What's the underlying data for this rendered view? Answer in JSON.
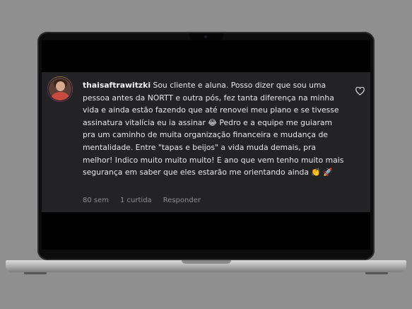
{
  "comment": {
    "username": "thaisaftrawitzki",
    "text": "Sou cliente e aluna. Posso dizer que sou uma pessoa antes da NORTT e outra pós, fez tanta diferença na minha vida e ainda estão fazendo que até renovei meu plano e se tivesse assinatura vitalícia eu ia assinar 😂 Pedro e a equipe me guiaram pra um caminho de muita organização financeira e mudança de mentalidade. Entre \"tapas e beijos\" a vida muda demais, pra melhor! Indico muito muito muito! E ano que vem tenho muito mais segurança em saber que eles estarão me orientando ainda 👏 🚀",
    "time": "80 sem",
    "likes": "1 curtida",
    "reply_label": "Responder"
  },
  "icons": {
    "like": "heart-outline-icon",
    "avatar": "user-avatar"
  },
  "colors": {
    "background": "#8f8f8f",
    "panel": "#232325",
    "text": "#e8e8e8",
    "meta": "#8e8e8e"
  }
}
